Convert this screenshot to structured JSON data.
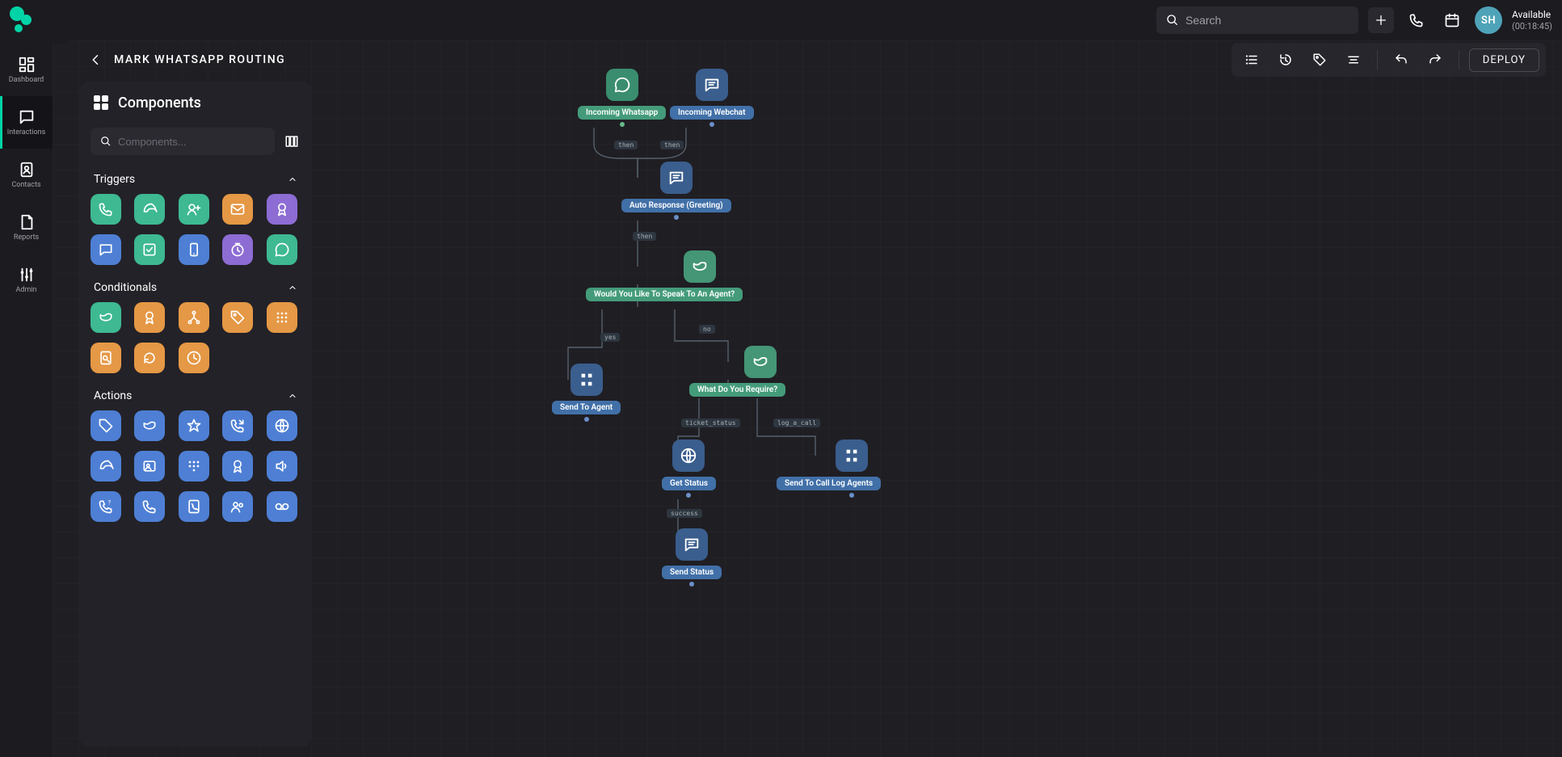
{
  "search": {
    "placeholder": "Search"
  },
  "user": {
    "initials": "SH",
    "status": "Available",
    "timer": "(00:18:45)"
  },
  "workspace": {
    "title": "MARK WHATSAPP ROUTING",
    "deploy_label": "DEPLOY"
  },
  "nav": {
    "items": [
      {
        "label": "Dashboard"
      },
      {
        "label": "Interactions"
      },
      {
        "label": "Contacts"
      },
      {
        "label": "Reports"
      },
      {
        "label": "Admin"
      }
    ],
    "active_index": 1
  },
  "components": {
    "title": "Components",
    "search_placeholder": "Components...",
    "sections": [
      {
        "name": "Triggers",
        "count": 10
      },
      {
        "name": "Conditionals",
        "count": 8
      },
      {
        "name": "Actions",
        "count": 15
      }
    ]
  },
  "flow": {
    "nodes": {
      "incoming_whatsapp": "Incoming Whatsapp",
      "incoming_webchat": "Incoming Webchat",
      "auto_response": "Auto Response (Greeting)",
      "speak_agent": "Would You Like To Speak To An Agent?",
      "what_require": "What Do You Require?",
      "send_to_agent": "Send To Agent",
      "get_status": "Get Status",
      "send_call_log": "Send To Call Log Agents",
      "send_status": "Send Status"
    },
    "edges": {
      "then1": "then",
      "then2": "then",
      "then3": "then",
      "yes": "yes",
      "no": "no",
      "ticket_status": "ticket_status",
      "log_a_call": "log_a_call",
      "success": "success"
    }
  }
}
